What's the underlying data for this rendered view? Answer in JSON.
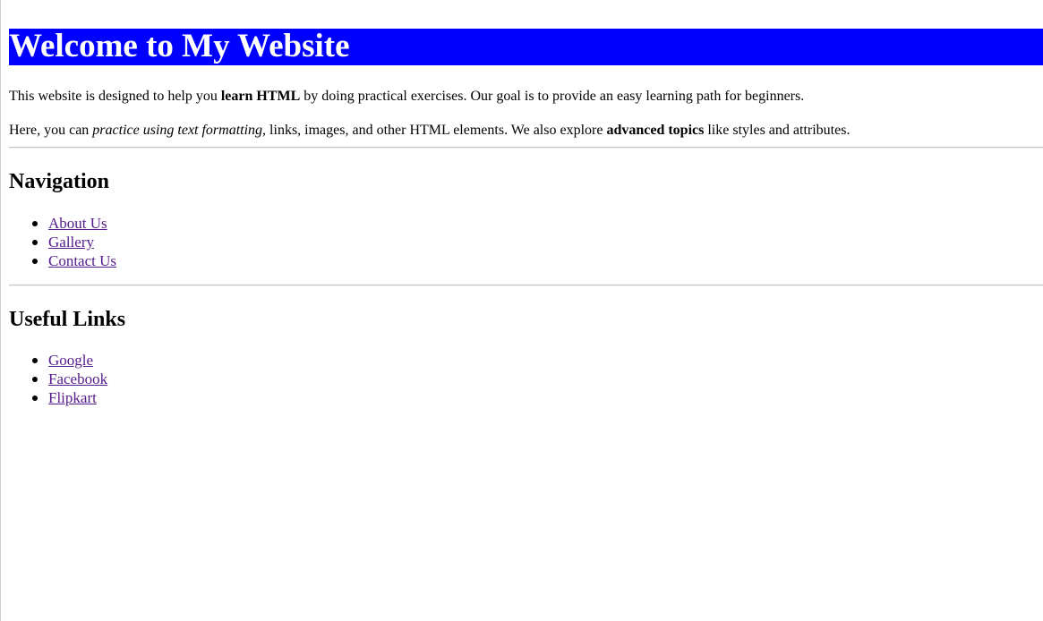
{
  "header": {
    "title": "Welcome to My Website",
    "background_color": "#0000ff",
    "text_color": "#ffffff"
  },
  "intro": {
    "paragraph1": {
      "before": "This website is designed to help you ",
      "bold": "learn HTML",
      "after": " by doing practical exercises. Our goal is to provide an easy learning path for beginners."
    },
    "paragraph2": {
      "before": "Here, you can ",
      "italic": "practice using text formatting",
      "middle": ", links, images, and other HTML elements. We also explore ",
      "bold": "advanced topics",
      "after": " like styles and attributes."
    }
  },
  "navigation": {
    "heading": "Navigation",
    "items": [
      {
        "label": "About Us",
        "icon": "bullet-icon"
      },
      {
        "label": "Gallery",
        "icon": "bullet-icon"
      },
      {
        "label": "Contact Us",
        "icon": "bullet-icon"
      }
    ]
  },
  "useful_links": {
    "heading": "Useful Links",
    "items": [
      {
        "label": "Google",
        "icon": "bullet-icon"
      },
      {
        "label": "Facebook",
        "icon": "bullet-icon"
      },
      {
        "label": "Flipkart",
        "icon": "bullet-icon"
      }
    ]
  },
  "colors": {
    "link_visited": "#551a8b",
    "divider": "#c4c4c4"
  }
}
